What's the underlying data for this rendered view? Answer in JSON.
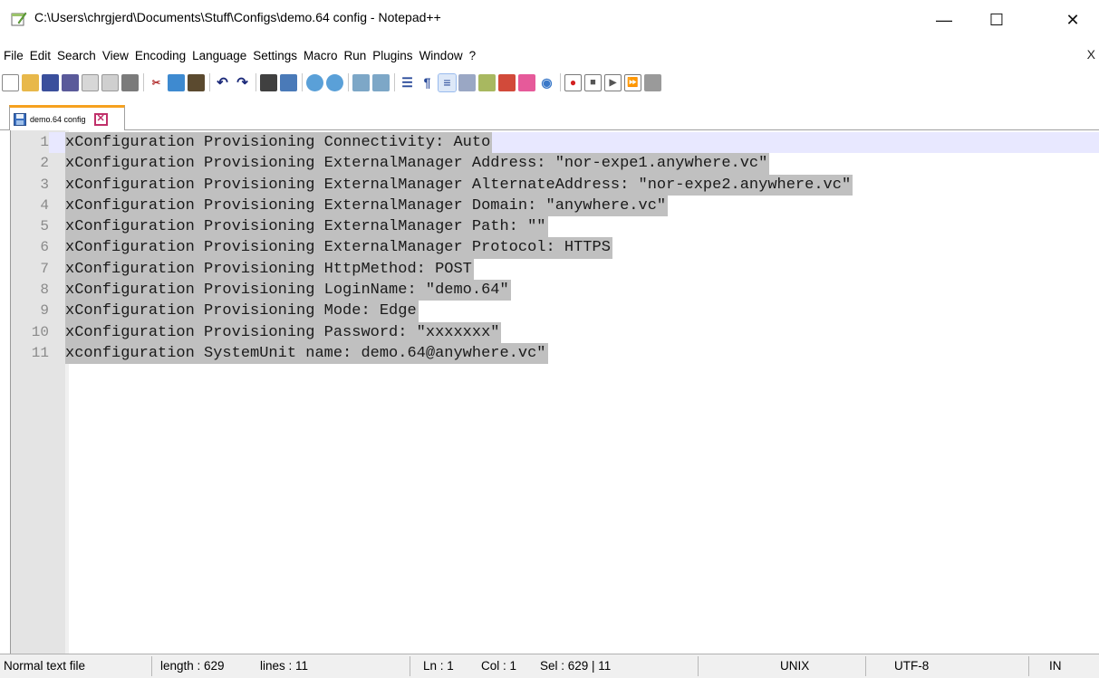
{
  "window": {
    "title": "C:\\Users\\chrgjerd\\Documents\\Stuff\\Configs\\demo.64 config - Notepad++",
    "minimize_glyph": "—",
    "maximize_glyph": "☐",
    "close_glyph": "✕"
  },
  "menu": {
    "items": [
      "File",
      "Edit",
      "Search",
      "View",
      "Encoding",
      "Language",
      "Settings",
      "Macro",
      "Run",
      "Plugins",
      "Window",
      "?"
    ],
    "close_doc": "X"
  },
  "toolbar": {
    "icons": [
      "new-file-icon",
      "open-file-icon",
      "save-icon",
      "save-all-icon",
      "close-icon",
      "close-all-icon",
      "print-icon",
      "cut-icon",
      "copy-icon",
      "paste-icon",
      "undo-icon",
      "redo-icon",
      "find-icon",
      "replace-icon",
      "zoom-in-icon",
      "zoom-out-icon",
      "sync-vertical-icon",
      "sync-horizontal-icon",
      "word-wrap-icon",
      "show-all-chars-icon",
      "indent-guide-icon",
      "user-language-icon",
      "document-map-icon",
      "function-list-icon",
      "folder-workspace-icon",
      "monitoring-icon",
      "record-macro-icon",
      "stop-macro-icon",
      "play-macro-icon",
      "run-macro-multiple-icon",
      "save-macro-icon"
    ]
  },
  "tab": {
    "label": "demo.64 config",
    "close_glyph": "✕"
  },
  "editor": {
    "lines": [
      {
        "num": "1",
        "text": "xConfiguration Provisioning Connectivity: Auto"
      },
      {
        "num": "2",
        "text": "xConfiguration Provisioning ExternalManager Address: \"nor-expe1.anywhere.vc\""
      },
      {
        "num": "3",
        "text": "xConfiguration Provisioning ExternalManager AlternateAddress: \"nor-expe2.anywhere.vc\""
      },
      {
        "num": "4",
        "text": "xConfiguration Provisioning ExternalManager Domain: \"anywhere.vc\""
      },
      {
        "num": "5",
        "text": "xConfiguration Provisioning ExternalManager Path: \"\""
      },
      {
        "num": "6",
        "text": "xConfiguration Provisioning ExternalManager Protocol: HTTPS"
      },
      {
        "num": "7",
        "text": "xConfiguration Provisioning HttpMethod: POST"
      },
      {
        "num": "8",
        "text": "xConfiguration Provisioning LoginName: \"demo.64\""
      },
      {
        "num": "9",
        "text": "xConfiguration Provisioning Mode: Edge"
      },
      {
        "num": "10",
        "text": "xConfiguration Provisioning Password: \"xxxxxxx\""
      },
      {
        "num": "11",
        "text": "xconfiguration SystemUnit name: demo.64@anywhere.vc\""
      }
    ]
  },
  "status": {
    "file_type": "Normal text file",
    "length": "length : 629",
    "lines": "lines : 11",
    "ln": "Ln : 1",
    "col": "Col : 1",
    "sel": "Sel : 629 | 11",
    "eol": "UNIX",
    "encoding": "UTF-8",
    "mode": "IN"
  },
  "colors": {
    "selection": "#c0c0c0",
    "current_line": "#e8e8ff",
    "gutter": "#e4e4e4",
    "tab_accent": "#f6a11f"
  }
}
